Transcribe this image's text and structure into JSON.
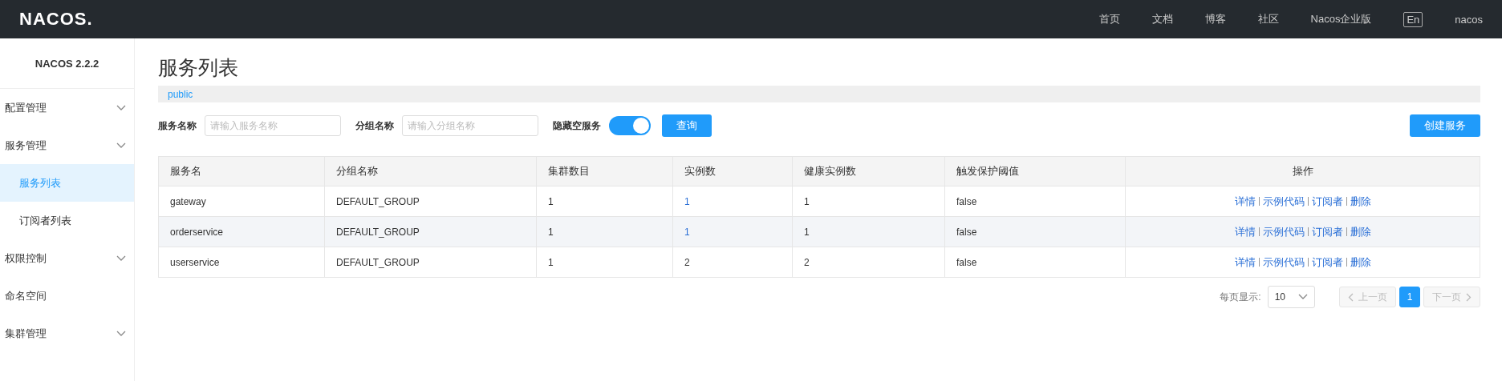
{
  "topbar": {
    "logo": "NACOS.",
    "links": [
      {
        "label": "首页",
        "kind": "link"
      },
      {
        "label": "文档",
        "kind": "link"
      },
      {
        "label": "博客",
        "kind": "link"
      },
      {
        "label": "社区",
        "kind": "link"
      },
      {
        "label": "Nacos企业版",
        "kind": "link"
      },
      {
        "label": "En",
        "kind": "language"
      },
      {
        "label": "nacos",
        "kind": "link"
      }
    ]
  },
  "sidebar": {
    "version": "NACOS 2.2.2",
    "items": [
      {
        "label": "配置管理",
        "kind": "group",
        "selected": false
      },
      {
        "label": "服务管理",
        "kind": "group",
        "selected": false,
        "children": [
          {
            "label": "服务列表",
            "selected": true
          },
          {
            "label": "订阅者列表",
            "selected": false
          }
        ]
      },
      {
        "label": "权限控制",
        "kind": "group",
        "selected": false
      },
      {
        "label": "命名空间",
        "kind": "link",
        "selected": false
      },
      {
        "label": "集群管理",
        "kind": "group",
        "selected": false
      }
    ]
  },
  "page": {
    "title": "服务列表",
    "namespace": "public"
  },
  "filters": {
    "fields": [
      {
        "label": "服务名称",
        "placeholder": "请输入服务名称"
      },
      {
        "label": "分组名称",
        "placeholder": "请输入分组名称"
      }
    ],
    "toggle": {
      "label": "隐藏空服务",
      "on": true
    },
    "query_button": "查询",
    "create_button": "创建服务"
  },
  "table": {
    "columns": [
      "服务名",
      "分组名称",
      "集群数目",
      "实例数",
      "健康实例数",
      "触发保护阈值",
      "操作"
    ],
    "rows": [
      {
        "name": "gateway",
        "group": "DEFAULT_GROUP",
        "clusters": "1",
        "instances": {
          "text": "1",
          "linked": true
        },
        "healthy": "1",
        "threshold": "false",
        "actions": [
          "详情",
          "示例代码",
          "订阅者",
          "删除"
        ],
        "highlighted": false
      },
      {
        "name": "orderservice",
        "group": "DEFAULT_GROUP",
        "clusters": "1",
        "instances": {
          "text": "1",
          "linked": true
        },
        "healthy": "1",
        "threshold": "false",
        "actions": [
          "详情",
          "示例代码",
          "订阅者",
          "删除"
        ],
        "highlighted": true
      },
      {
        "name": "userservice",
        "group": "DEFAULT_GROUP",
        "clusters": "1",
        "instances": {
          "text": "2",
          "linked": false
        },
        "healthy": "2",
        "threshold": "false",
        "actions": [
          "详情",
          "示例代码",
          "订阅者",
          "删除"
        ],
        "highlighted": false
      }
    ]
  },
  "pagination": {
    "page_size_label": "每页显示:",
    "page_size": "10",
    "prev": {
      "label": "上一页",
      "disabled": true
    },
    "pages": [
      {
        "label": "1",
        "selected": true
      }
    ],
    "next": {
      "label": "下一页",
      "disabled": true
    }
  }
}
